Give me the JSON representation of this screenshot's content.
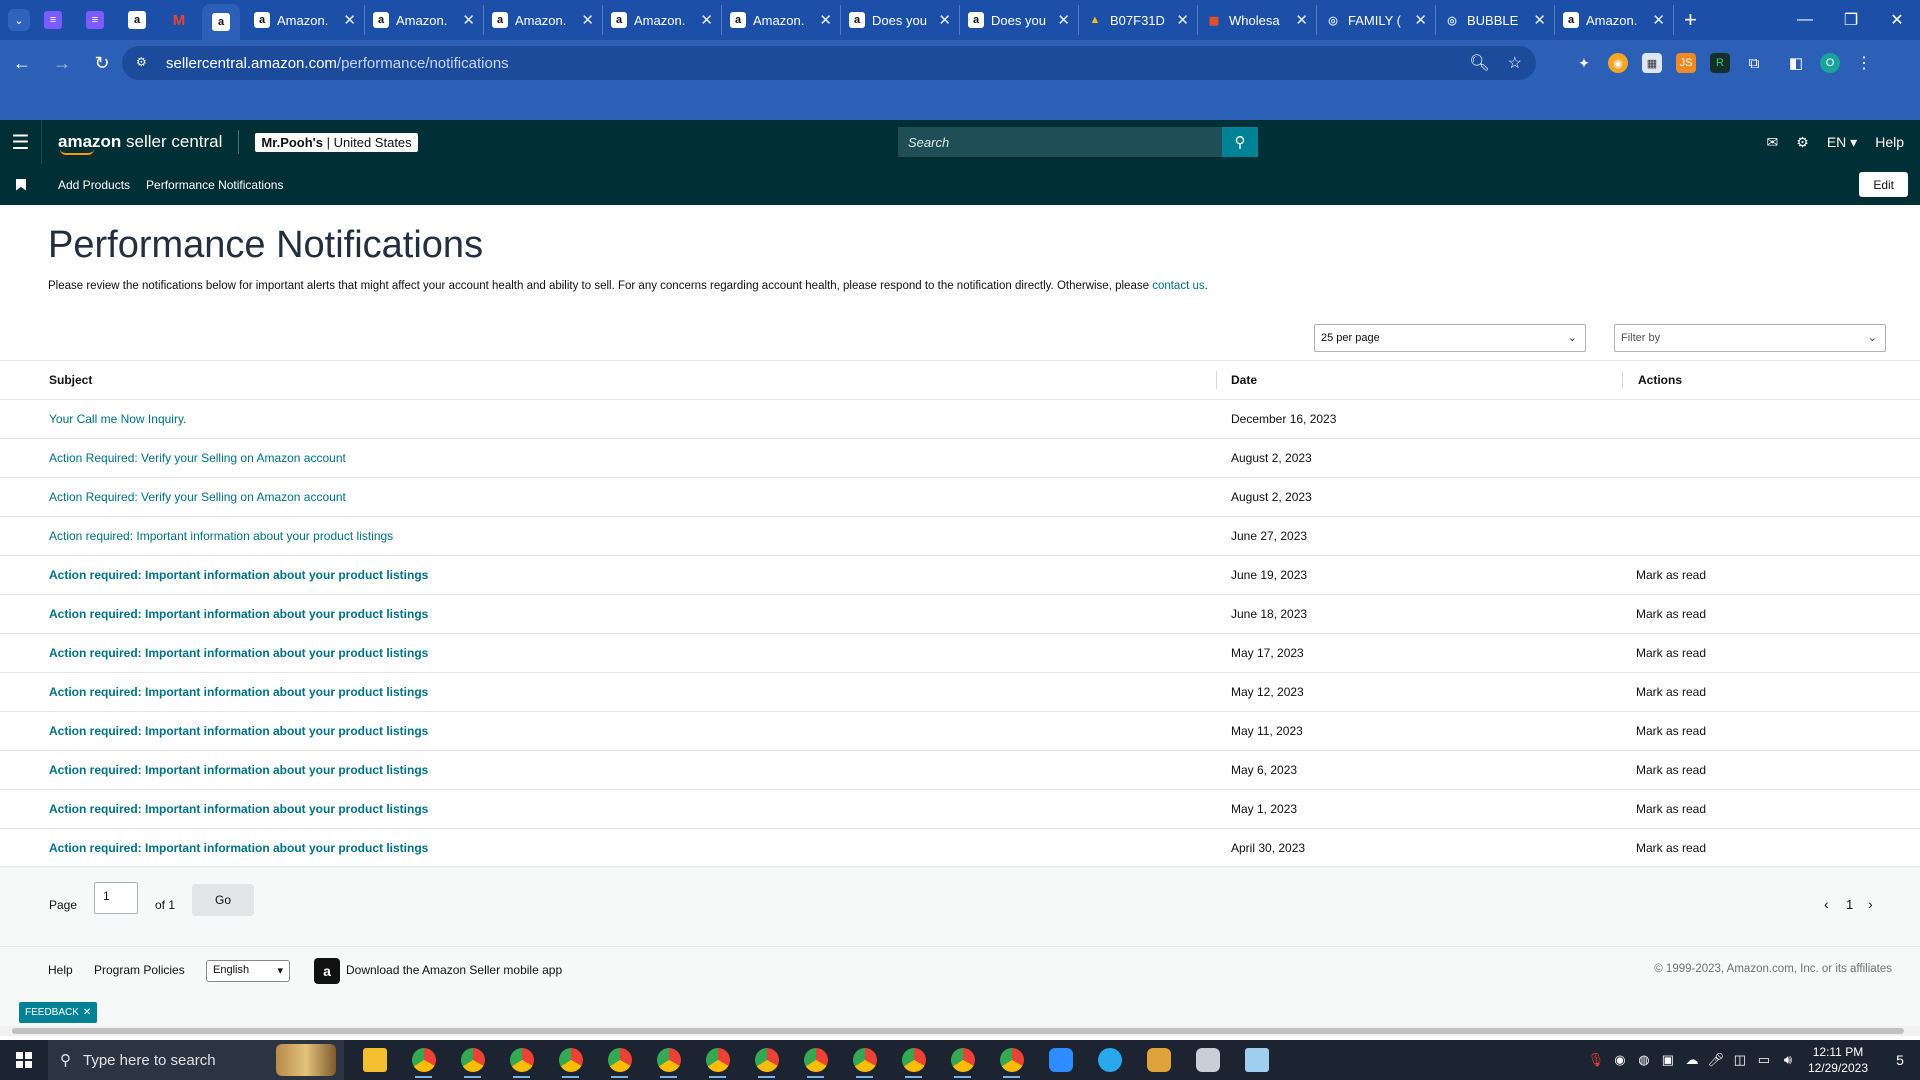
{
  "browser": {
    "tabs": [
      {
        "title": "Amazon.",
        "icon": "amazon-icon"
      },
      {
        "title": "Amazon.",
        "icon": "amazon-icon"
      },
      {
        "title": "Amazon.",
        "icon": "amazon-icon"
      },
      {
        "title": "Amazon.",
        "icon": "amazon-icon"
      },
      {
        "title": "Amazon.",
        "icon": "amazon-icon"
      },
      {
        "title": "Does you",
        "icon": "amazon-icon"
      },
      {
        "title": "Does you",
        "icon": "amazon-icon"
      },
      {
        "title": "B07F31D",
        "icon": "google-drive-icon"
      },
      {
        "title": "Wholesa",
        "icon": "microsoft-icon"
      },
      {
        "title": "FAMILY (",
        "icon": "globe-icon"
      },
      {
        "title": "BUBBLE",
        "icon": "globe-icon"
      },
      {
        "title": "Amazon.",
        "icon": "amazon-icon"
      }
    ],
    "url_host": "sellercentral.amazon.com",
    "url_path": "/performance/notifications",
    "profile_initial": "O"
  },
  "header": {
    "logo_text": "amazon",
    "logo_suffix": " seller central",
    "store_name": "Mr.Pooh's",
    "store_region": " | United States",
    "search_placeholder": "Search",
    "language": "EN",
    "help": "Help"
  },
  "subnav": {
    "links": [
      "Add Products",
      "Performance Notifications"
    ],
    "edit_label": "Edit"
  },
  "page": {
    "title": "Performance Notifications",
    "intro": "Please review the notifications below for important alerts that might affect your account health and ability to sell. For any concerns regarding account health, please respond to the notification directly. Otherwise, please ",
    "intro_link": "contact us",
    "intro_end": ".",
    "per_page": "25 per page",
    "filter_placeholder": "Filter by"
  },
  "table": {
    "headers": {
      "subject": "Subject",
      "date": "Date",
      "actions": "Actions"
    },
    "rows": [
      {
        "subject": "Your Call me Now Inquiry.",
        "date": "December 16, 2023",
        "action": "",
        "unread": false
      },
      {
        "subject": "Action Required: Verify your Selling on Amazon account",
        "date": "August 2, 2023",
        "action": "",
        "unread": false
      },
      {
        "subject": "Action Required: Verify your Selling on Amazon account",
        "date": "August 2, 2023",
        "action": "",
        "unread": false
      },
      {
        "subject": "Action required: Important information about your product listings",
        "date": "June 27, 2023",
        "action": "",
        "unread": false
      },
      {
        "subject": "Action required: Important information about your product listings",
        "date": "June 19, 2023",
        "action": "Mark as read",
        "unread": true
      },
      {
        "subject": "Action required: Important information about your product listings",
        "date": "June 18, 2023",
        "action": "Mark as read",
        "unread": true
      },
      {
        "subject": "Action required: Important information about your product listings",
        "date": "May 17, 2023",
        "action": "Mark as read",
        "unread": true
      },
      {
        "subject": "Action required: Important information about your product listings",
        "date": "May 12, 2023",
        "action": "Mark as read",
        "unread": true
      },
      {
        "subject": "Action required: Important information about your product listings",
        "date": "May 11, 2023",
        "action": "Mark as read",
        "unread": true
      },
      {
        "subject": "Action required: Important information about your product listings",
        "date": "May 6, 2023",
        "action": "Mark as read",
        "unread": true
      },
      {
        "subject": "Action required: Important information about your product listings",
        "date": "May 1, 2023",
        "action": "Mark as read",
        "unread": true
      },
      {
        "subject": "Action required: Important information about your product listings",
        "date": "April 30, 2023",
        "action": "Mark as read",
        "unread": true
      }
    ]
  },
  "pagination": {
    "page_label": "Page",
    "page_value": "1",
    "of_label": "of 1",
    "go_label": "Go",
    "current": "1"
  },
  "footer": {
    "help": "Help",
    "policies": "Program Policies",
    "language": "English",
    "app_text": "Download the Amazon Seller mobile app",
    "copyright": "© 1999-2023, Amazon.com, Inc. or its affiliates",
    "feedback": "FEEDBACK"
  },
  "taskbar": {
    "search_placeholder": "Type here to search",
    "time": "12:11 PM",
    "date": "12/29/2023",
    "notification_count": "5"
  },
  "colors": {
    "chrome_blue": "#2c5fb6",
    "header_teal": "#002f36",
    "link": "#007185",
    "accent": "#008296"
  }
}
